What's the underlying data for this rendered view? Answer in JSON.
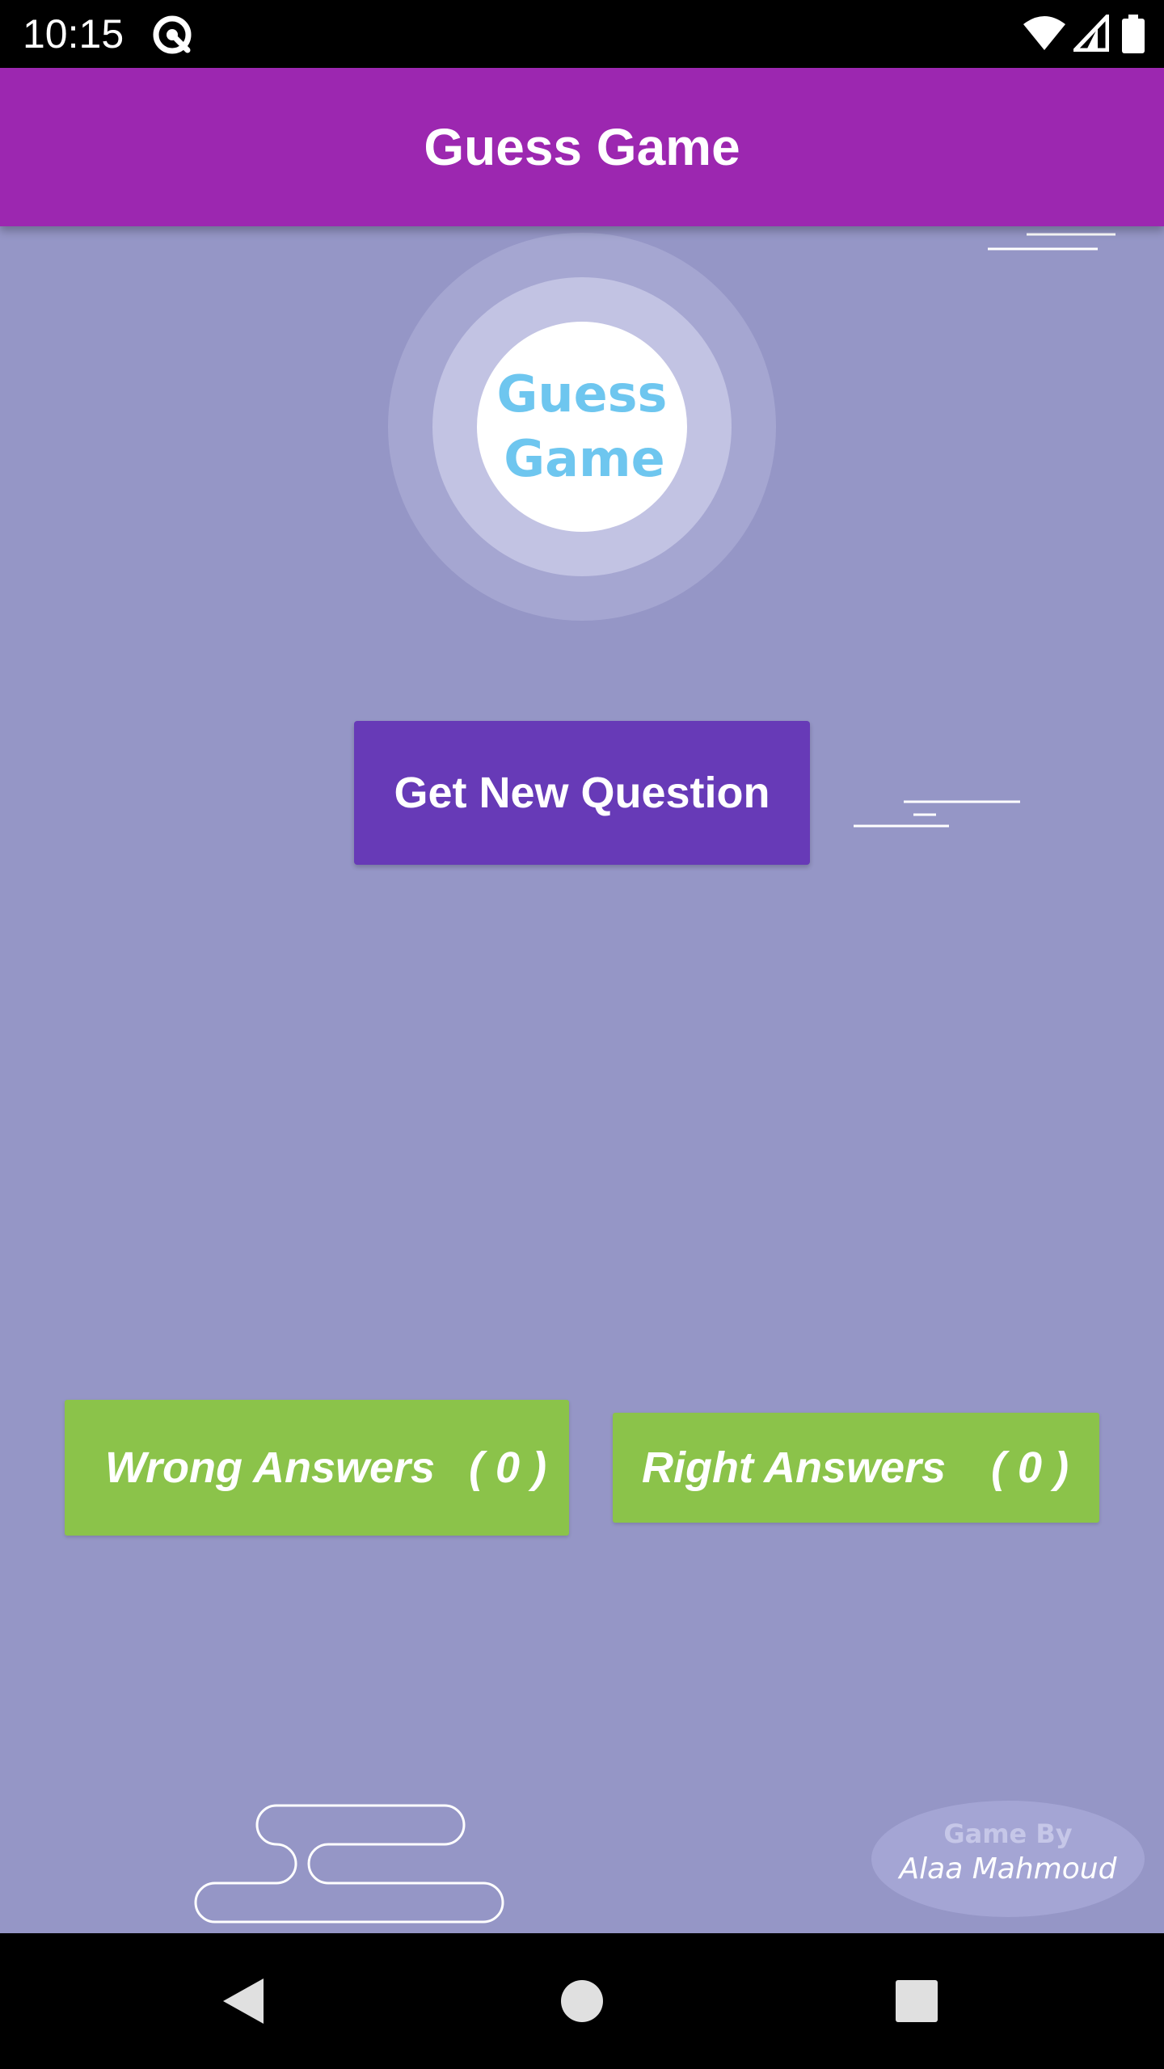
{
  "status_bar": {
    "time": "10:15",
    "icons": [
      "at-sign-icon",
      "wifi-icon",
      "signal-icon",
      "battery-icon"
    ]
  },
  "app_bar": {
    "title": "Guess Game",
    "color": "#9c27b0"
  },
  "logo": {
    "line1": "Guess",
    "line2": "Game",
    "text_color": "#6ec6ef"
  },
  "actions": {
    "new_question_label": "Get New Question",
    "button_color": "#673ab7"
  },
  "scores": {
    "wrong_label": "Wrong Answers",
    "wrong_count": "( 0 )",
    "right_label": "Right Answers",
    "right_count": "( 0 )",
    "box_color": "#8bc34a"
  },
  "credit": {
    "line1": "Game By",
    "line2": "Alaa Mahmoud"
  },
  "nav_bar": {
    "buttons": [
      "back-icon",
      "home-icon",
      "recents-icon"
    ]
  },
  "colors": {
    "background": "#9596c6"
  }
}
